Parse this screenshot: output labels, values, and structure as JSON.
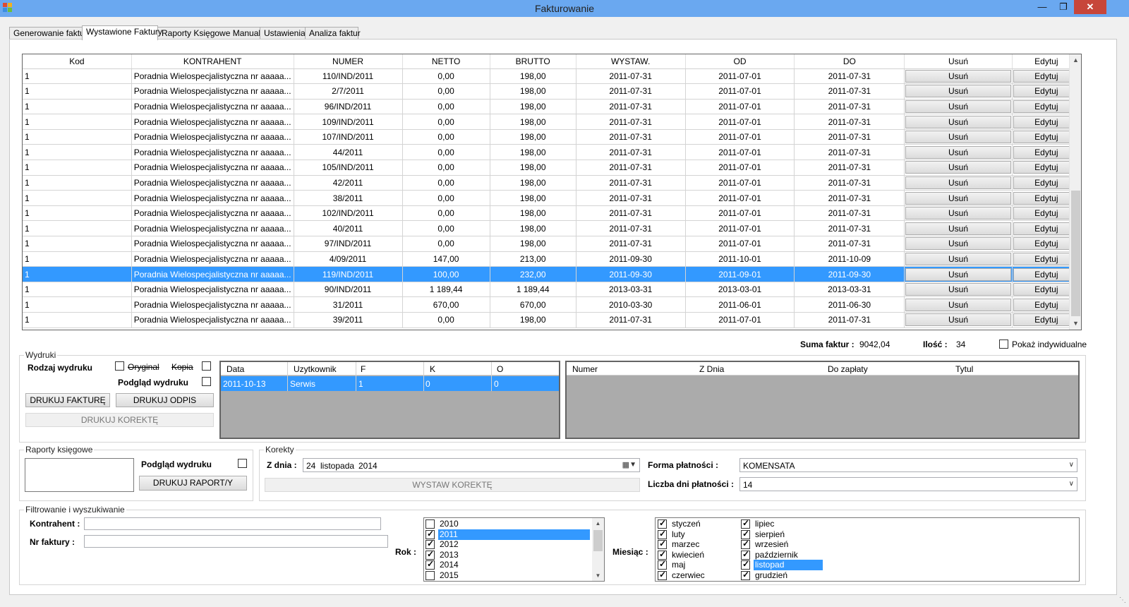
{
  "window": {
    "title": "Fakturowanie",
    "minimize": "—",
    "restore": "❐",
    "close": "✕"
  },
  "tabs": [
    {
      "label": "Generowanie faktur"
    },
    {
      "label": "Wystawione Faktury"
    },
    {
      "label": "Raporty Księgowe Manualnie"
    },
    {
      "label": "Ustawienia"
    },
    {
      "label": "Analiza faktur"
    }
  ],
  "invoices": {
    "columns": [
      "Kod",
      "KONTRAHENT",
      "NUMER",
      "NETTO",
      "BRUTTO",
      "WYSTAW.",
      "OD",
      "DO",
      "Usuń",
      "Edytuj"
    ],
    "delete_label": "Usuń",
    "edit_label": "Edytuj",
    "rows": [
      {
        "kod": "1",
        "kontrahent": "Poradnia Wielospecjalistyczna nr aaaaa...",
        "numer": "110/IND/2011",
        "netto": "0,00",
        "brutto": "198,00",
        "wystaw": "2011-07-31",
        "od": "2011-07-01",
        "do": "2011-07-31"
      },
      {
        "kod": "1",
        "kontrahent": "Poradnia Wielospecjalistyczna nr aaaaa...",
        "numer": "2/7/2011",
        "netto": "0,00",
        "brutto": "198,00",
        "wystaw": "2011-07-31",
        "od": "2011-07-01",
        "do": "2011-07-31"
      },
      {
        "kod": "1",
        "kontrahent": "Poradnia Wielospecjalistyczna nr aaaaa...",
        "numer": "96/IND/2011",
        "netto": "0,00",
        "brutto": "198,00",
        "wystaw": "2011-07-31",
        "od": "2011-07-01",
        "do": "2011-07-31"
      },
      {
        "kod": "1",
        "kontrahent": "Poradnia Wielospecjalistyczna nr aaaaa...",
        "numer": "109/IND/2011",
        "netto": "0,00",
        "brutto": "198,00",
        "wystaw": "2011-07-31",
        "od": "2011-07-01",
        "do": "2011-07-31"
      },
      {
        "kod": "1",
        "kontrahent": "Poradnia Wielospecjalistyczna nr aaaaa...",
        "numer": "107/IND/2011",
        "netto": "0,00",
        "brutto": "198,00",
        "wystaw": "2011-07-31",
        "od": "2011-07-01",
        "do": "2011-07-31"
      },
      {
        "kod": "1",
        "kontrahent": "Poradnia Wielospecjalistyczna nr aaaaa...",
        "numer": "44/2011",
        "netto": "0,00",
        "brutto": "198,00",
        "wystaw": "2011-07-31",
        "od": "2011-07-01",
        "do": "2011-07-31"
      },
      {
        "kod": "1",
        "kontrahent": "Poradnia Wielospecjalistyczna nr aaaaa...",
        "numer": "105/IND/2011",
        "netto": "0,00",
        "brutto": "198,00",
        "wystaw": "2011-07-31",
        "od": "2011-07-01",
        "do": "2011-07-31"
      },
      {
        "kod": "1",
        "kontrahent": "Poradnia Wielospecjalistyczna nr aaaaa...",
        "numer": "42/2011",
        "netto": "0,00",
        "brutto": "198,00",
        "wystaw": "2011-07-31",
        "od": "2011-07-01",
        "do": "2011-07-31"
      },
      {
        "kod": "1",
        "kontrahent": "Poradnia Wielospecjalistyczna nr aaaaa...",
        "numer": "38/2011",
        "netto": "0,00",
        "brutto": "198,00",
        "wystaw": "2011-07-31",
        "od": "2011-07-01",
        "do": "2011-07-31"
      },
      {
        "kod": "1",
        "kontrahent": "Poradnia Wielospecjalistyczna nr aaaaa...",
        "numer": "102/IND/2011",
        "netto": "0,00",
        "brutto": "198,00",
        "wystaw": "2011-07-31",
        "od": "2011-07-01",
        "do": "2011-07-31"
      },
      {
        "kod": "1",
        "kontrahent": "Poradnia Wielospecjalistyczna nr aaaaa...",
        "numer": "40/2011",
        "netto": "0,00",
        "brutto": "198,00",
        "wystaw": "2011-07-31",
        "od": "2011-07-01",
        "do": "2011-07-31"
      },
      {
        "kod": "1",
        "kontrahent": "Poradnia Wielospecjalistyczna nr aaaaa...",
        "numer": "97/IND/2011",
        "netto": "0,00",
        "brutto": "198,00",
        "wystaw": "2011-07-31",
        "od": "2011-07-01",
        "do": "2011-07-31"
      },
      {
        "kod": "1",
        "kontrahent": "Poradnia Wielospecjalistyczna nr aaaaa...",
        "numer": "4/09/2011",
        "netto": "147,00",
        "brutto": "213,00",
        "wystaw": "2011-09-30",
        "od": "2011-10-01",
        "do": "2011-10-09"
      },
      {
        "kod": "1",
        "kontrahent": "Poradnia Wielospecjalistyczna nr aaaaa...",
        "numer": "119/IND/2011",
        "netto": "100,00",
        "brutto": "232,00",
        "wystaw": "2011-09-30",
        "od": "2011-09-01",
        "do": "2011-09-30",
        "selected": true
      },
      {
        "kod": "1",
        "kontrahent": "Poradnia Wielospecjalistyczna nr aaaaa...",
        "numer": "90/IND/2011",
        "netto": "1 189,44",
        "brutto": "1 189,44",
        "wystaw": "2013-03-31",
        "od": "2013-03-01",
        "do": "2013-03-31"
      },
      {
        "kod": "1",
        "kontrahent": "Poradnia Wielospecjalistyczna nr aaaaa...",
        "numer": "31/2011",
        "netto": "670,00",
        "brutto": "670,00",
        "wystaw": "2010-03-30",
        "od": "2011-06-01",
        "do": "2011-06-30"
      },
      {
        "kod": "1",
        "kontrahent": "Poradnia Wielospecjalistyczna nr aaaaa...",
        "numer": "39/2011",
        "netto": "0,00",
        "brutto": "198,00",
        "wystaw": "2011-07-31",
        "od": "2011-07-01",
        "do": "2011-07-31"
      }
    ]
  },
  "summary": {
    "suma_label": "Suma faktur :",
    "suma_value": "9042,04",
    "ilosc_label": "Ilość :",
    "ilosc_value": "34",
    "pokaz_label": "Pokaż indywidualne"
  },
  "wydruki": {
    "title": "Wydruki",
    "rodzaj_label": "Rodzaj wydruku",
    "oryginal_label": "Oryginal",
    "kopia_label": "Kopia",
    "podglad_label": "Podgląd wydruku",
    "drukuj_fakture": "DRUKUJ FAKTURĘ",
    "drukuj_odpis": "DRUKUJ ODPIS",
    "drukuj_korekte": "DRUKUJ KOREKTĘ",
    "prints": {
      "columns": [
        "Data",
        "Uzytkownik",
        "F",
        "K",
        "O"
      ],
      "row": [
        "2011-10-13",
        "Serwis",
        "1",
        "0",
        "0"
      ]
    },
    "payments": {
      "columns": [
        "Numer",
        "Z Dnia",
        "Do zapłaty",
        "Tytul"
      ]
    }
  },
  "raporty": {
    "title": "Raporty księgowe",
    "podglad_label": "Podgląd wydruku",
    "drukuj_raport": "DRUKUJ RAPORT/Y"
  },
  "korekty": {
    "title": "Korekty",
    "z_dnia_label": "Z dnia :",
    "date_day": "24",
    "date_month": "listopada",
    "date_year": "2014",
    "wystaw_korekte": "WYSTAW KOREKTĘ",
    "forma_label": "Forma płatności :",
    "forma_value": "KOMENSATA",
    "liczba_label": "Liczba dni płatności :",
    "liczba_value": "14"
  },
  "filtr": {
    "title": "Filtrowanie i wyszukiwanie",
    "kontrahent_label": "Kontrahent :",
    "kontrahent_value": "",
    "nr_label": "Nr faktury :",
    "nr_value": "",
    "rok_label": "Rok :",
    "miesiac_label": "Miesiąc :",
    "years": [
      {
        "label": "2010",
        "checked": false
      },
      {
        "label": "2011",
        "checked": true,
        "highlighted": true
      },
      {
        "label": "2012",
        "checked": true
      },
      {
        "label": "2013",
        "checked": true
      },
      {
        "label": "2014",
        "checked": true
      },
      {
        "label": "2015",
        "checked": false
      }
    ],
    "months": [
      {
        "label": "styczeń",
        "checked": true
      },
      {
        "label": "luty",
        "checked": true
      },
      {
        "label": "marzec",
        "checked": true
      },
      {
        "label": "kwiecień",
        "checked": true
      },
      {
        "label": "maj",
        "checked": true
      },
      {
        "label": "czerwiec",
        "checked": true
      },
      {
        "label": "lipiec",
        "checked": true
      },
      {
        "label": "sierpień",
        "checked": true
      },
      {
        "label": "wrzesień",
        "checked": true
      },
      {
        "label": "październik",
        "checked": true
      },
      {
        "label": "listopad",
        "checked": true,
        "highlighted": true
      },
      {
        "label": "grudzień",
        "checked": true
      }
    ]
  },
  "colors": {
    "titlebar": "#6aa8f0",
    "selection": "#3399ff",
    "close": "#c7463a"
  }
}
